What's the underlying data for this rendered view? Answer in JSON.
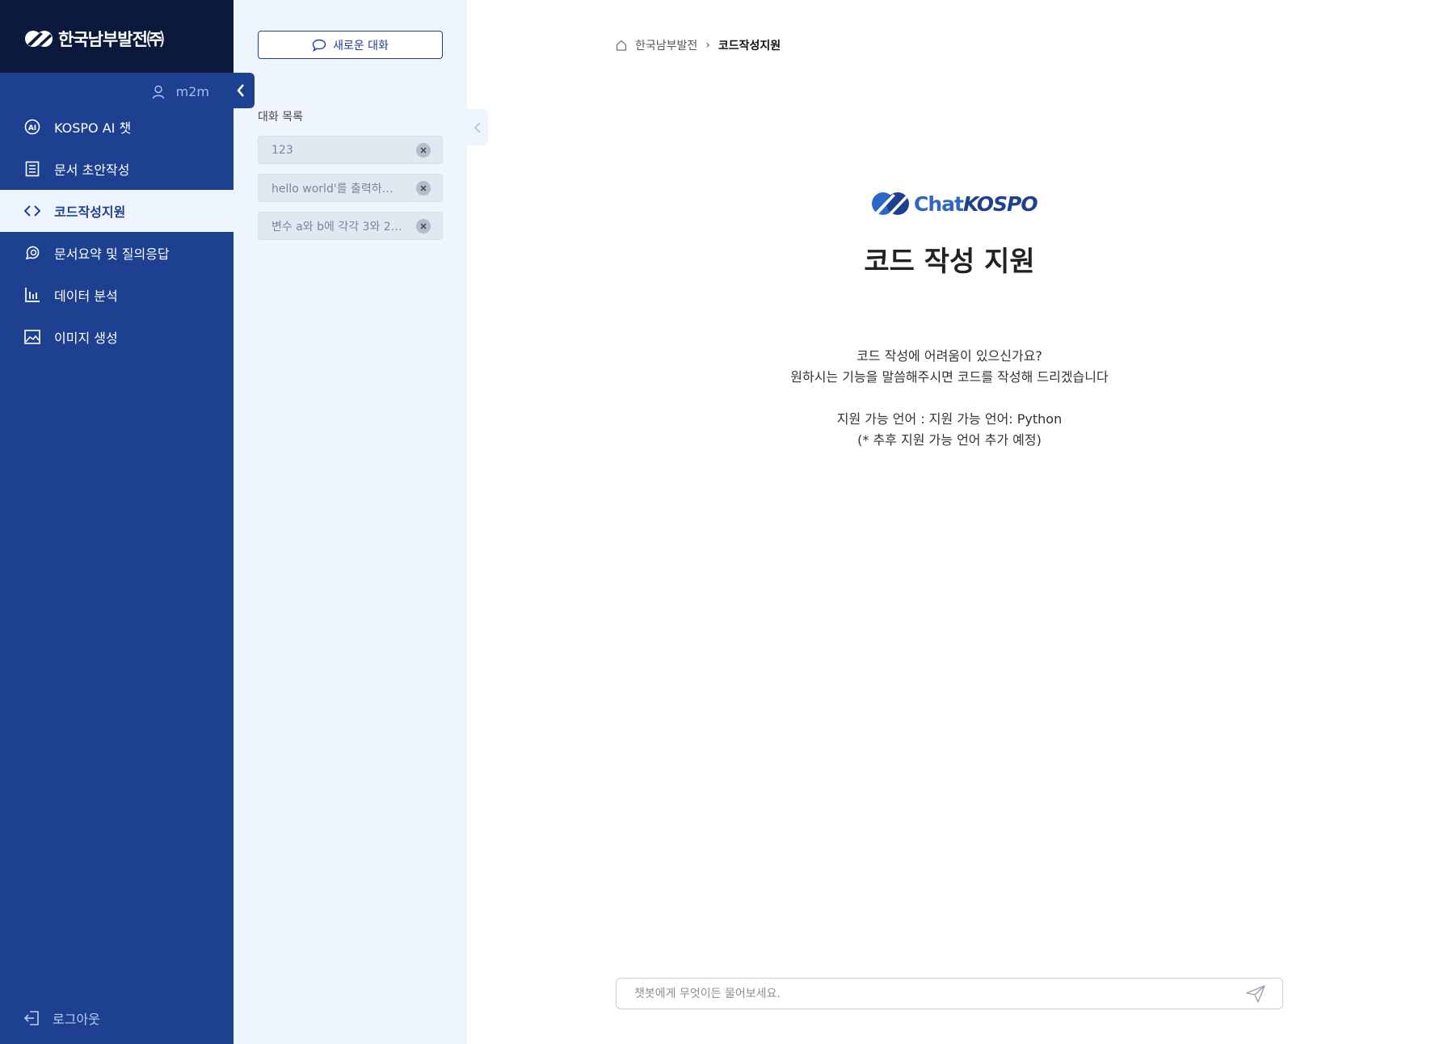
{
  "brand": {
    "logo_text": "한국남부발전㈜",
    "chat_brand_part1": "Chat",
    "chat_brand_part2": "KOSPO"
  },
  "user": {
    "name": "m2m"
  },
  "nav": {
    "items": [
      {
        "label": "KOSPO AI 챗",
        "icon": "ai-chat-icon",
        "active": false
      },
      {
        "label": "문서 초안작성",
        "icon": "document-icon",
        "active": false
      },
      {
        "label": "코드작성지원",
        "icon": "code-icon",
        "active": true
      },
      {
        "label": "문서요약 및 질의응답",
        "icon": "chat-bubbles-icon",
        "active": false
      },
      {
        "label": "데이터 분석",
        "icon": "bar-chart-icon",
        "active": false
      },
      {
        "label": "이미지 생성",
        "icon": "image-icon",
        "active": false
      }
    ],
    "logout_label": "로그아웃"
  },
  "panel": {
    "new_chat_label": "새로운 대화",
    "list_title": "대화 목록",
    "conversations": [
      {
        "title": "123"
      },
      {
        "title": "hello world'를 출력하…"
      },
      {
        "title": "변수 a와 b에 각각 3와 2…"
      }
    ]
  },
  "breadcrumb": {
    "home": "한국남부발전",
    "separator": "›",
    "current": "코드작성지원"
  },
  "main": {
    "title": "코드 작성 지원",
    "description_lines": [
      "코드 작성에 어려움이 있으신가요?",
      "원하시는 기능을 말씀해주시면 코드를 작성해 드리겠습니다",
      "",
      "지원 가능 언어 : 지원 가능 언어: Python",
      "(* 추후 지원 가능 언어 추가 예정)"
    ]
  },
  "input": {
    "placeholder": "챗봇에게 무엇이든 물어보세요.",
    "value": ""
  },
  "colors": {
    "nav_bg": "#1d4090",
    "logo_bar_bg": "#0b1a3c",
    "panel_bg": "#eff5fd",
    "active_item_bg": "#eef4fd",
    "accent": "#2f67c9"
  }
}
